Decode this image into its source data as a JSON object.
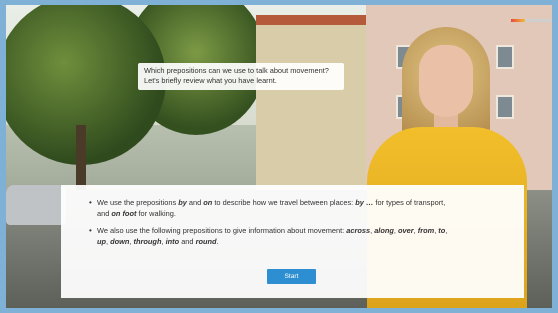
{
  "question": {
    "line1": "Which prepositions can we use to talk about movement?",
    "line2": "Let's briefly review what you have learnt."
  },
  "panel": {
    "item1": {
      "t1": "We use the prepositions ",
      "b1": "by",
      "t2": " and ",
      "b2": "on",
      "t3": " to describe how we travel between places: ",
      "b3": "by …",
      "t4": " for types of transport,",
      "t5": "and ",
      "b4": "on foot",
      "t6": " for walking."
    },
    "item2": {
      "t1": "We also use the following prepositions to give information about movement: ",
      "w1": "across",
      "w2": "along",
      "w3": "over",
      "w4": "from",
      "w5": "to",
      "w6": "up",
      "w7": "down",
      "w8": "through",
      "w9": "into",
      "and": "and",
      "w10": "round"
    },
    "start_label": "Start"
  },
  "progress": {
    "fraction": 0.35
  },
  "colors": {
    "accent": "#2d8fd2",
    "shirt": "#f2bf2b"
  }
}
